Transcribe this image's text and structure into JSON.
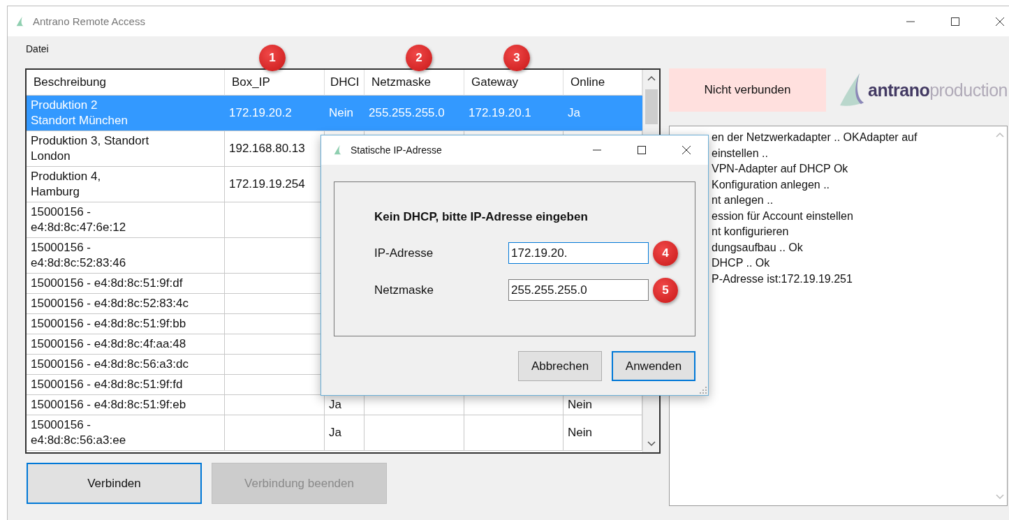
{
  "window": {
    "title": "Antrano Remote Access"
  },
  "menu": [
    "Datei"
  ],
  "table": {
    "columns": [
      "Beschreibung",
      "Box_IP",
      "DHCI",
      "Netzmaske",
      "Gateway",
      "Online"
    ],
    "rows": [
      {
        "description": "Produktion 2\nStandort München",
        "box_ip": "172.19.20.2",
        "dhcp": "Nein",
        "netzmaske": "255.255.255.0",
        "gateway": "172.19.20.1",
        "online": "Ja",
        "selected": true
      },
      {
        "description": "Produktion 3, Standort\nLondon",
        "box_ip": "192.168.80.13",
        "selected": false
      },
      {
        "description": "Produktion 4,\nHamburg",
        "box_ip": "172.19.19.254",
        "selected": false
      },
      {
        "description": "15000156 -\ne4:8d:8c:47:6e:12",
        "selected": false
      },
      {
        "description": "15000156 -\ne4:8d:8c:52:83:46",
        "selected": false
      },
      {
        "description": "15000156 - e4:8d:8c:51:9f:df",
        "selected": false
      },
      {
        "description": "15000156 - e4:8d:8c:52:83:4c",
        "selected": false
      },
      {
        "description": "15000156 - e4:8d:8c:51:9f:bb",
        "selected": false
      },
      {
        "description": "15000156 - e4:8d:8c:4f:aa:48",
        "selected": false
      },
      {
        "description": "15000156 - e4:8d:8c:56:a3:dc",
        "selected": false
      },
      {
        "description": "15000156 - e4:8d:8c:51:9f:fd",
        "selected": false
      },
      {
        "description": "15000156 - e4:8d:8c:51:9f:eb",
        "dhcp": "Ja",
        "online": "Nein",
        "selected": false
      },
      {
        "description": "15000156 -\ne4:8d:8c:56:a3:ee",
        "dhcp": "Ja",
        "online": "Nein",
        "selected": false
      }
    ]
  },
  "column_badges": [
    "1",
    "2",
    "3"
  ],
  "buttons": [
    {
      "label": "Verbinden",
      "default": true,
      "disabled": false
    },
    {
      "label": "Verbindung beenden",
      "default": false,
      "disabled": true
    }
  ],
  "status": {
    "label": "Nicht verbunden",
    "connected": false
  },
  "logo": "**antrano**production",
  "log_lines": [
    "en der Netzwerkadapter .. OKAdapter auf",
    "einstellen ..",
    "VPN-Adapter auf DHCP Ok",
    "Konfiguration anlegen ..",
    "nt anlegen ..",
    "ession für Account einstellen",
    "nt konfigurieren",
    "dungsaufbau .. Ok",
    "DHCP ..  Ok",
    "P-Adresse ist:172.19.19.251"
  ],
  "dialog": {
    "title": "Statische IP-Adresse",
    "heading": "Kein DHCP, bitte IP-Adresse eingeben",
    "fields": [
      {
        "label": "IP-Adresse",
        "value": "172.19.20.",
        "focused": true,
        "badge": "4"
      },
      {
        "label": "Netzmaske",
        "value": "255.255.255.0",
        "focused": false,
        "badge": "5"
      }
    ],
    "buttons": [
      {
        "label": "Abbrechen",
        "default": false
      },
      {
        "label": "Anwenden",
        "default": true
      }
    ]
  }
}
